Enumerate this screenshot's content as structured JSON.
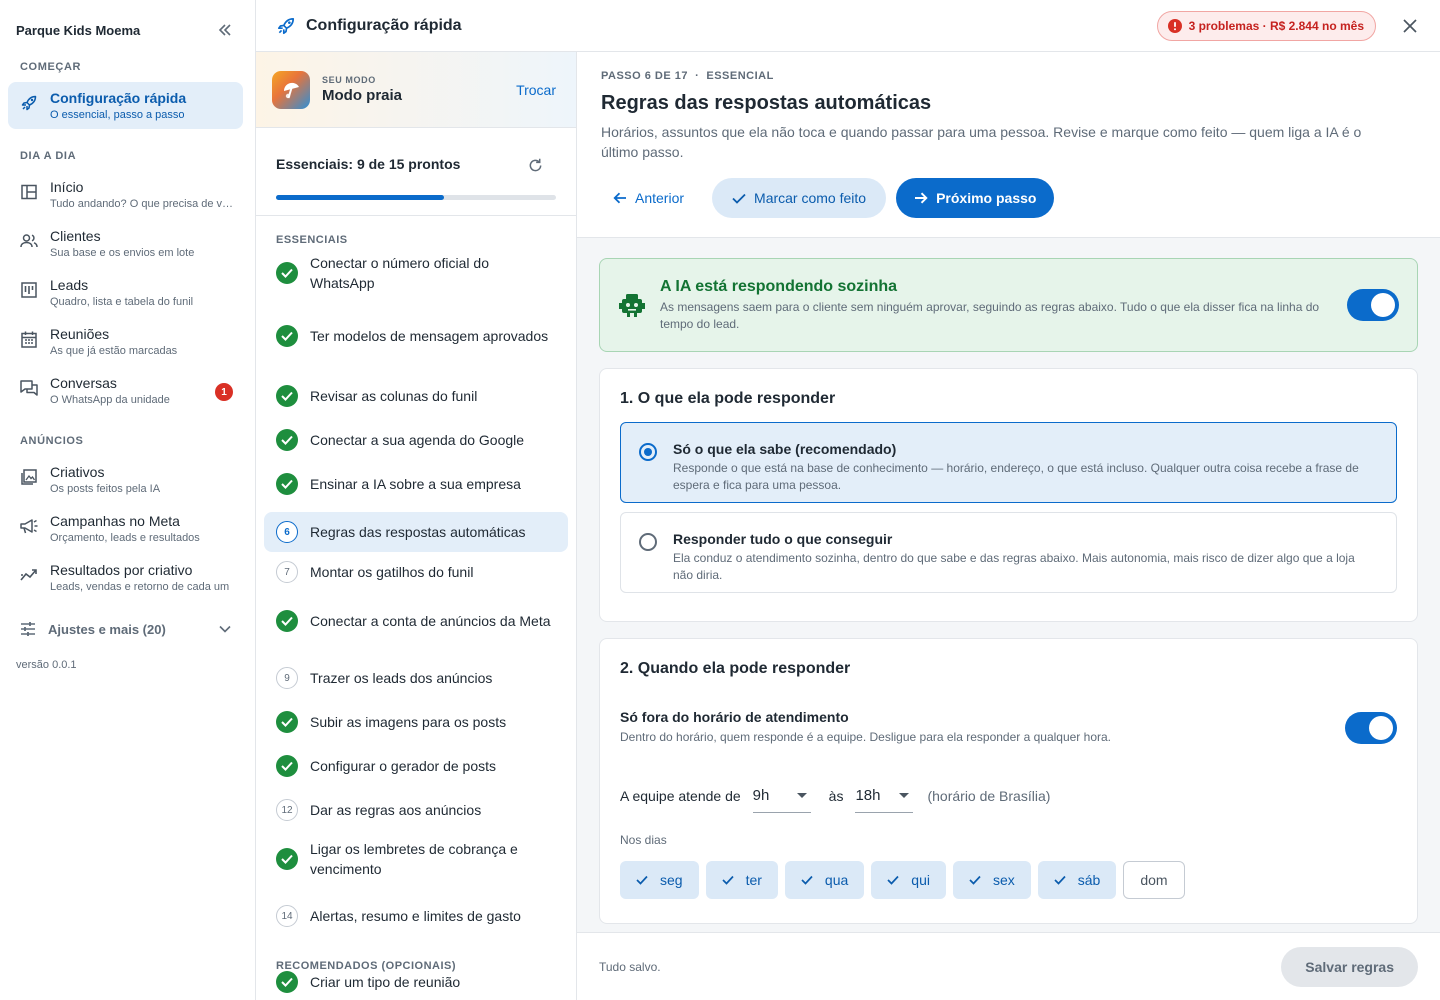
{
  "sidebar": {
    "title": "Parque Kids Moema",
    "sections": {
      "comecar": "COMEÇAR",
      "dia_a_dia": "DIA A DIA",
      "anuncios": "ANÚNCIOS"
    },
    "items": [
      {
        "label": "Configuração rápida",
        "sub": "O essencial, passo a passo",
        "icon": "rocket-icon"
      },
      {
        "label": "Início",
        "sub": "Tudo andando? O que precisa de você",
        "icon": "dashboard-icon"
      },
      {
        "label": "Clientes",
        "sub": "Sua base e os envios em lote",
        "icon": "people-icon"
      },
      {
        "label": "Leads",
        "sub": "Quadro, lista e tabela do funil",
        "icon": "kanban-icon"
      },
      {
        "label": "Reuniões",
        "sub": "As que já estão marcadas",
        "icon": "calendar-icon"
      },
      {
        "label": "Conversas",
        "sub": "O WhatsApp da unidade",
        "icon": "chat-icon",
        "badge": "1"
      },
      {
        "label": "Criativos",
        "sub": "Os posts feitos pela IA",
        "icon": "image-icon"
      },
      {
        "label": "Campanhas no Meta",
        "sub": "Orçamento, leads e resultados",
        "icon": "megaphone-icon"
      },
      {
        "label": "Resultados por criativo",
        "sub": "Leads, vendas e retorno de cada um",
        "icon": "trend-icon"
      }
    ],
    "more": "Ajustes e mais (20)",
    "version": "versão 0.0.1"
  },
  "topbar": {
    "title": "Configuração rápida",
    "problems": "3 problemas · R$ 2.844 no mês"
  },
  "steps": {
    "mode_caption": "SEU MODO",
    "mode_name": "Modo praia",
    "mode_change": "Trocar",
    "progress_label": "Essenciais: 9 de 15 prontos",
    "progress_fraction": 0.6,
    "group_essential": "ESSENCIAIS",
    "group_recommended": "RECOMENDADOS (OPCIONAIS)",
    "list": [
      {
        "label": "Conectar o número oficial do WhatsApp",
        "done": true
      },
      {
        "label": "Ter modelos de mensagem aprovados",
        "done": true
      },
      {
        "label": "Revisar as colunas do funil",
        "done": true
      },
      {
        "label": "Conectar a sua agenda do Google",
        "done": true
      },
      {
        "label": "Ensinar a IA sobre a sua empresa",
        "done": true
      },
      {
        "label": "Regras das respostas automáticas",
        "num": "6",
        "current": true
      },
      {
        "label": "Montar os gatilhos do funil",
        "num": "7"
      },
      {
        "label": "Conectar a conta de anúncios da Meta",
        "done": true
      },
      {
        "label": "Trazer os leads dos anúncios",
        "num": "9"
      },
      {
        "label": "Subir as imagens para os posts",
        "done": true
      },
      {
        "label": "Configurar o gerador de posts",
        "done": true
      },
      {
        "label": "Dar as regras aos anúncios",
        "num": "12"
      },
      {
        "label": "Ligar os lembretes de cobrança e vencimento",
        "done": true
      },
      {
        "label": "Alertas, resumo e limites de gasto",
        "num": "14"
      },
      {
        "label": "Criar um tipo de reunião",
        "done": true
      }
    ]
  },
  "main": {
    "crumb": "PASSO 6 DE 17  ·  ESSENCIAL",
    "title": "Regras das respostas automáticas",
    "desc": "Horários, assuntos que ela não toca e quando passar para uma pessoa. Revise e marque como feito — quem liga a IA é o último passo.",
    "prev": "Anterior",
    "mark_done": "Marcar como feito",
    "next": "Próximo passo",
    "ai_title": "A IA está respondendo sozinha",
    "ai_desc": "As mensagens saem para o cliente sem ninguém aprovar, seguindo as regras abaixo. Tudo o que ela disser fica na linha do tempo do lead.",
    "ai_on": true,
    "s1_title": "1. O que ela pode responder",
    "opt1_title": "Só o que ela sabe (recomendado)",
    "opt1_desc": "Responde o que está na base de conhecimento — horário, endereço, o que está incluso. Qualquer outra coisa recebe a frase de espera e fica para uma pessoa.",
    "opt2_title": "Responder tudo o que conseguir",
    "opt2_desc": "Ela conduz o atendimento sozinha, dentro do que sabe e das regras abaixo. Mais autonomia, mais risco de dizer algo que a loja não diria.",
    "s2_title": "2. Quando ela pode responder",
    "only_outside": "Só fora do horário de atendimento",
    "only_outside_desc": "Dentro do horário, quem responde é a equipe. Desligue para ela responder a qualquer hora.",
    "hours_prefix": "A equipe atende de",
    "hours_from": "9h",
    "hours_mid": "às",
    "hours_to": "18h",
    "hours_tz": "(horário de Brasília)",
    "days_label": "Nos dias",
    "days": [
      {
        "label": "seg",
        "on": true
      },
      {
        "label": "ter",
        "on": true
      },
      {
        "label": "qua",
        "on": true
      },
      {
        "label": "qui",
        "on": true
      },
      {
        "label": "sex",
        "on": true
      },
      {
        "label": "sáb",
        "on": true
      },
      {
        "label": "dom",
        "on": false
      }
    ],
    "saved": "Tudo salvo.",
    "save": "Salvar regras"
  },
  "colors": {
    "accent": "#0b6bcb",
    "success": "#1e8e3e",
    "danger": "#d93025"
  }
}
